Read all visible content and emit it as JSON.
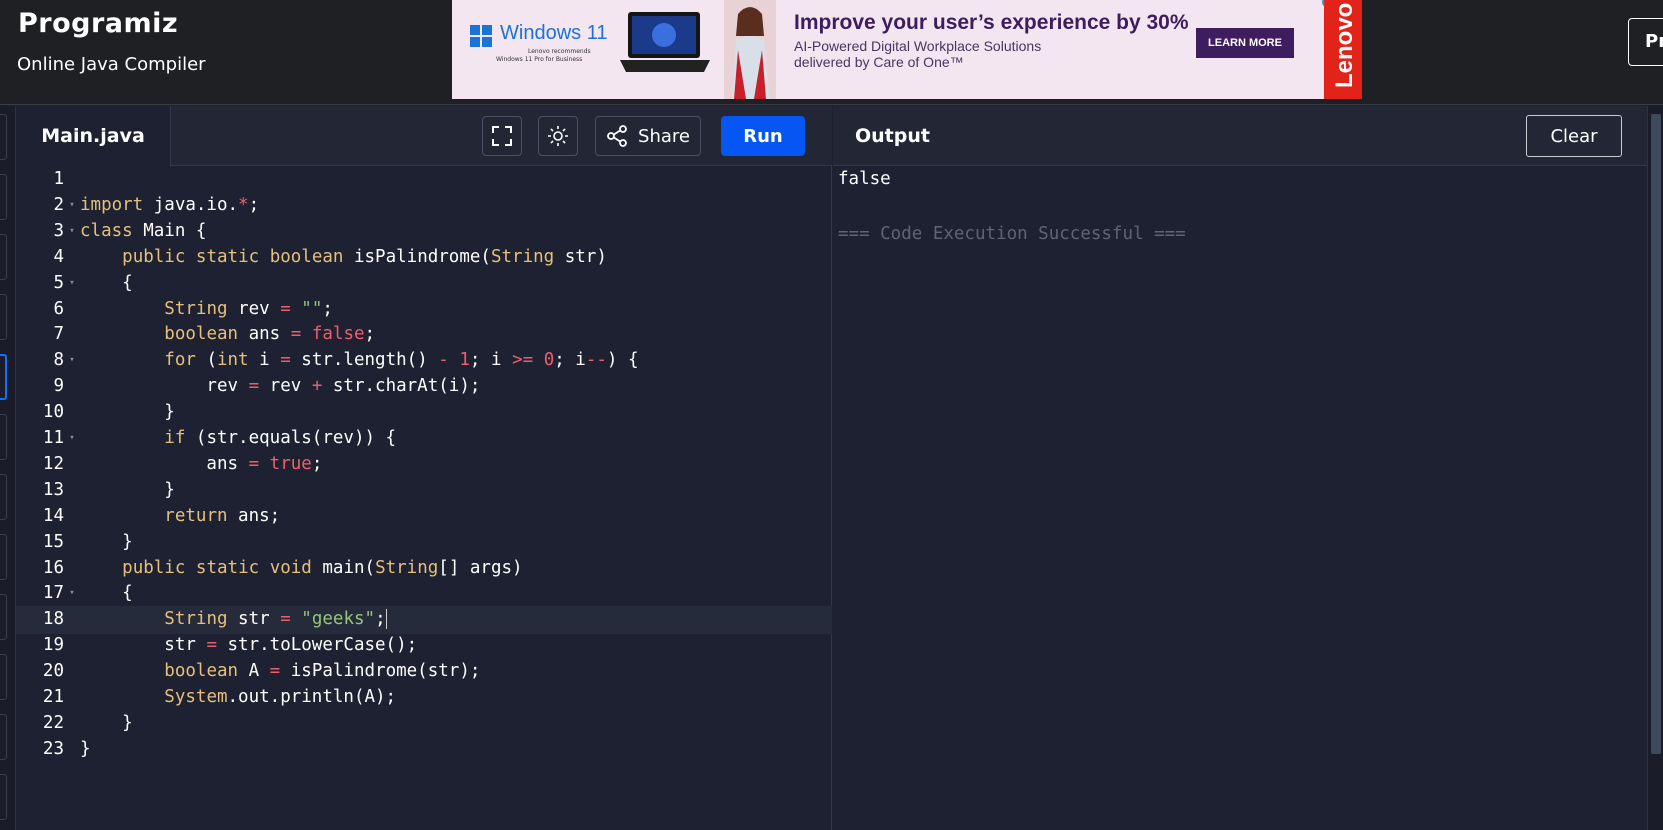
{
  "header": {
    "logo": "Programiz",
    "subtitle": "Online Java Compiler",
    "right_button": "Pr"
  },
  "ad": {
    "windows_label": "Windows 11",
    "windows_small1": "Lenovo recommends",
    "windows_small2": "Windows 11 Pro for Business",
    "headline": "Improve your user’s experience by 30%",
    "body_line1": "AI-Powered Digital Workplace Solutions",
    "body_line2": "delivered by Care of One™",
    "cta": "LEARN MORE",
    "brand": "Lenovo"
  },
  "editor": {
    "file_tab": "Main.java",
    "share_label": "Share",
    "run_label": "Run",
    "active_line": 18,
    "lines": [
      {
        "num": "1",
        "fold": false,
        "html": ""
      },
      {
        "num": "2",
        "fold": true,
        "html": "<span class=\"kw\">import</span> java.io.<span class=\"op\">*</span>;"
      },
      {
        "num": "3",
        "fold": true,
        "html": "<span class=\"kw\">class</span> Main {"
      },
      {
        "num": "4",
        "fold": false,
        "html": "    <span class=\"kw\">public</span> <span class=\"kw\">static</span> <span class=\"kw\">boolean</span> isPalindrome(<span class=\"kw\">String</span> str)"
      },
      {
        "num": "5",
        "fold": true,
        "html": "    {"
      },
      {
        "num": "6",
        "fold": false,
        "html": "        <span class=\"kw\">String</span> rev <span class=\"op\">=</span> <span class=\"str\">\"\"</span>;"
      },
      {
        "num": "7",
        "fold": false,
        "html": "        <span class=\"kw\">boolean</span> ans <span class=\"op\">=</span> <span class=\"num\">false</span>;"
      },
      {
        "num": "8",
        "fold": true,
        "html": "        <span class=\"kw\">for</span> (<span class=\"kw\">int</span> i <span class=\"op\">=</span> str.length() <span class=\"op\">-</span> <span class=\"num\">1</span>; i <span class=\"op\">&gt;=</span> <span class=\"num\">0</span>; i<span class=\"op\">--</span>) {"
      },
      {
        "num": "9",
        "fold": false,
        "html": "            rev <span class=\"op\">=</span> rev <span class=\"op\">+</span> str.charAt(i);"
      },
      {
        "num": "10",
        "fold": false,
        "html": "        }"
      },
      {
        "num": "11",
        "fold": true,
        "html": "        <span class=\"kw\">if</span> (str.equals(rev)) {"
      },
      {
        "num": "12",
        "fold": false,
        "html": "            ans <span class=\"op\">=</span> <span class=\"num\">true</span>;"
      },
      {
        "num": "13",
        "fold": false,
        "html": "        }"
      },
      {
        "num": "14",
        "fold": false,
        "html": "        <span class=\"kw\">return</span> ans;"
      },
      {
        "num": "15",
        "fold": false,
        "html": "    }"
      },
      {
        "num": "16",
        "fold": false,
        "html": "    <span class=\"kw\">public</span> <span class=\"kw\">static</span> <span class=\"kw\">void</span> main(<span class=\"kw\">String</span>[] args)"
      },
      {
        "num": "17",
        "fold": true,
        "html": "    {"
      },
      {
        "num": "18",
        "fold": false,
        "html": "        <span class=\"kw\">String</span> str <span class=\"op\">=</span> <span class=\"str\">\"geeks\"</span>;<span class=\"cursor\"></span>"
      },
      {
        "num": "19",
        "fold": false,
        "html": "        str <span class=\"op\">=</span> str.toLowerCase();"
      },
      {
        "num": "20",
        "fold": false,
        "html": "        <span class=\"kw\">boolean</span> A <span class=\"op\">=</span> isPalindrome(str);"
      },
      {
        "num": "21",
        "fold": false,
        "html": "        <span class=\"kw\">System</span>.out.println(A);"
      },
      {
        "num": "22",
        "fold": false,
        "html": "    }"
      },
      {
        "num": "23",
        "fold": false,
        "html": "}"
      }
    ]
  },
  "output": {
    "title": "Output",
    "clear_label": "Clear",
    "lines": [
      {
        "text": "false",
        "muted": false
      },
      {
        "text": "",
        "muted": false
      },
      {
        "text": "=== Code Execution Successful ===",
        "muted": true
      }
    ]
  },
  "colors": {
    "run_button": "#0556f3",
    "keyword": "#e6c07b",
    "number_literal": "#ef5f6b",
    "string_literal": "#98c379",
    "editor_background": "#1d2131",
    "ad_brand": "#e2231a"
  },
  "icons": [
    "fullscreen-icon",
    "theme-sun-icon",
    "share-icon"
  ]
}
